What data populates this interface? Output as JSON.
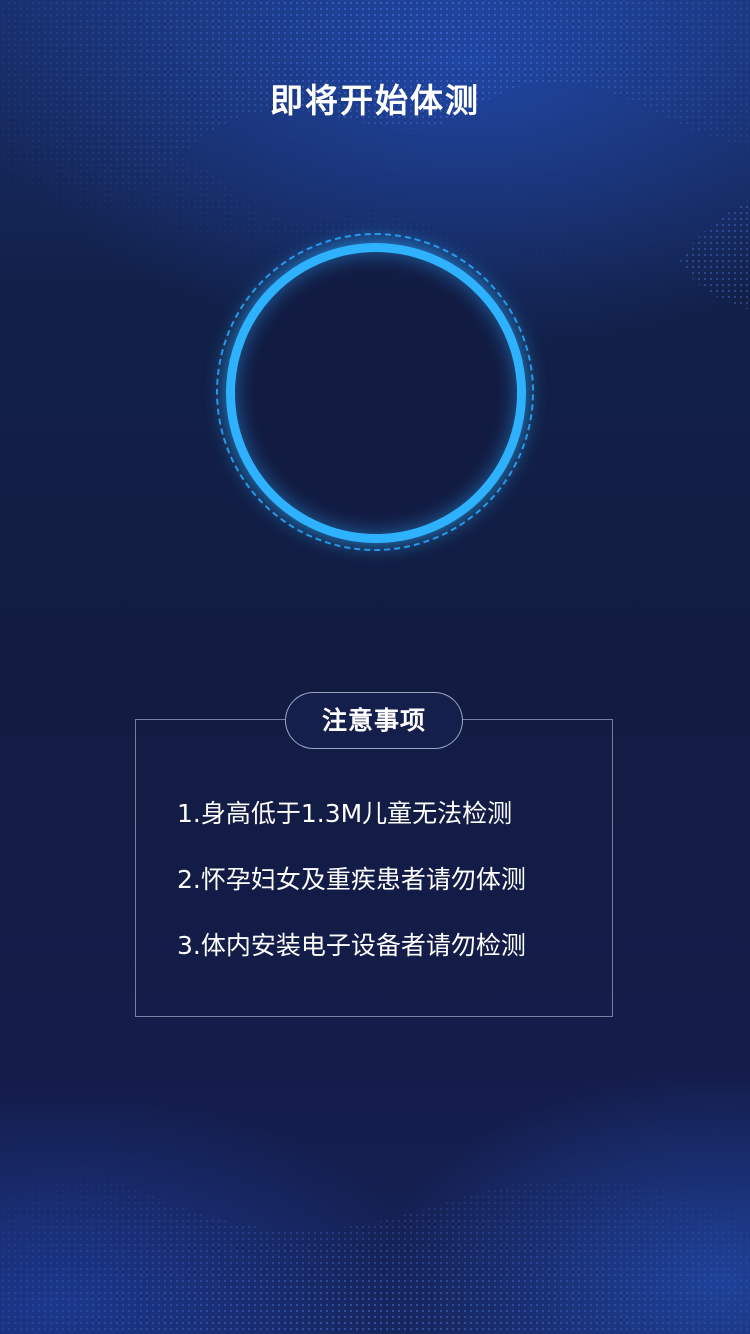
{
  "title": "即将开始体测",
  "notice": {
    "heading": "注意事项",
    "items": [
      "1.身高低于1.3M儿童无法检测",
      "2.怀孕妇女及重疾患者请勿体测",
      "3.体内安装电子设备者请勿检测"
    ]
  },
  "colors": {
    "accent": "#2eb2ff",
    "background": "#121c42",
    "text": "#ffffff"
  }
}
